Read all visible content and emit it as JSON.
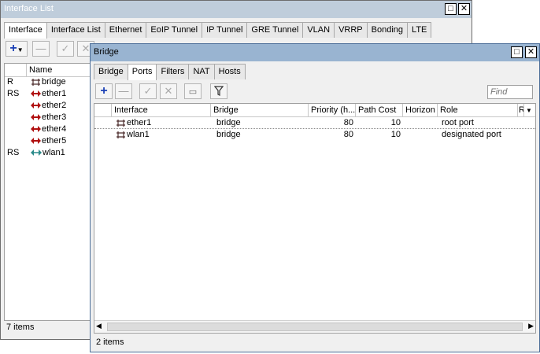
{
  "interface_window": {
    "title": "Interface List",
    "tabs": [
      "Interface",
      "Interface List",
      "Ethernet",
      "EoIP Tunnel",
      "IP Tunnel",
      "GRE Tunnel",
      "VLAN",
      "VRRP",
      "Bonding",
      "LTE"
    ],
    "active_tab": "Interface",
    "columns": [
      "Name"
    ],
    "rows": [
      {
        "flags": "R",
        "name": "bridge",
        "icon": "bridge-icon"
      },
      {
        "flags": "RS",
        "name": "ether1",
        "icon": "ethernet-icon"
      },
      {
        "flags": "",
        "name": "ether2",
        "icon": "ethernet-icon"
      },
      {
        "flags": "",
        "name": "ether3",
        "icon": "ethernet-icon"
      },
      {
        "flags": "",
        "name": "ether4",
        "icon": "ethernet-icon"
      },
      {
        "flags": "",
        "name": "ether5",
        "icon": "ethernet-icon"
      },
      {
        "flags": "RS",
        "name": "wlan1",
        "icon": "wireless-icon"
      }
    ],
    "status": "7 items"
  },
  "bridge_window": {
    "title": "Bridge",
    "tabs": [
      "Bridge",
      "Ports",
      "Filters",
      "NAT",
      "Hosts"
    ],
    "active_tab": "Ports",
    "find_placeholder": "Find",
    "columns": [
      "Interface",
      "Bridge",
      "Priority (h...",
      "Path Cost",
      "Horizon",
      "Role",
      "R"
    ],
    "rows": [
      {
        "interface": "ether1",
        "bridge": "bridge",
        "priority": "80",
        "path_cost": "10",
        "horizon": "",
        "role": "root port"
      },
      {
        "interface": "wlan1",
        "bridge": "bridge",
        "priority": "80",
        "path_cost": "10",
        "horizon": "",
        "role": "designated port"
      }
    ],
    "status": "2 items"
  },
  "colors": {
    "active_titlebar": "#99b4d1",
    "inactive_titlebar": "#bfcddb",
    "window_bg": "#f0f0f0",
    "add_blue": "#1a3fb5"
  }
}
